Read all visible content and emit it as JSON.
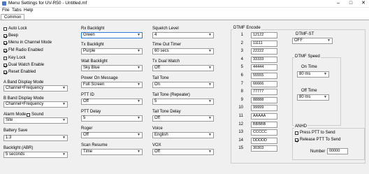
{
  "window": {
    "title": "Menu Settings for UV-R50 - Untitled.mf"
  },
  "menu": [
    "File",
    "Tabs",
    "Help"
  ],
  "tab": "Common",
  "col1": {
    "checks": [
      {
        "label": "Auto Lock",
        "checked": false
      },
      {
        "label": "Beep",
        "checked": true
      },
      {
        "label": "Menu in Channel Mode",
        "checked": true
      },
      {
        "label": "FM Radio Enabled",
        "checked": true
      },
      {
        "label": "Key Lock",
        "checked": false
      },
      {
        "label": "Dual Watch Enable",
        "checked": true
      },
      {
        "label": "Reset Enabled",
        "checked": true
      }
    ],
    "a_band_label": "A Band Display Mode",
    "a_band_value": "Channel+Frequency",
    "b_band_label": "B Band Display Mode",
    "b_band_value": "Channel+Frequency",
    "alarm_label": "Alarm Mode",
    "sound_label": "Sound",
    "alarm_value": "Site",
    "battery_label": "Battery Save",
    "battery_value": "1:3",
    "backlight_label": "Backlight (ABR)",
    "backlight_value": "5 seconds"
  },
  "col2": [
    {
      "label": "Rx Backlight",
      "value": "Green"
    },
    {
      "label": "Tx Backlight",
      "value": "Purple"
    },
    {
      "label": "Wait Backlight",
      "value": "Sky Blue"
    },
    {
      "label": "Power On Message",
      "value": "Full Screen"
    },
    {
      "label": "PTT ID",
      "value": "Off"
    },
    {
      "label": "PTT Delay",
      "value": "5"
    },
    {
      "label": "Roger",
      "value": "Off"
    },
    {
      "label": "Scan Resume",
      "value": "Time"
    }
  ],
  "col3": [
    {
      "label": "Squelch Level",
      "value": "4"
    },
    {
      "label": "Time Out Timer",
      "value": "60 secs"
    },
    {
      "label": "Tx Dual Watch",
      "value": "Off"
    },
    {
      "label": "Tail Tone",
      "value": "On"
    },
    {
      "label": "Tail Tone (Repeater)",
      "value": "5"
    },
    {
      "label": "Tail Tone Delay",
      "value": "Off"
    },
    {
      "label": "Voice",
      "value": "English"
    },
    {
      "label": "VOX",
      "value": "Off"
    }
  ],
  "dtmf": {
    "title": "DTMF Encode",
    "rows": [
      {
        "n": "1",
        "v": "12122"
      },
      {
        "n": "2",
        "v": "11111"
      },
      {
        "n": "3",
        "v": "22222"
      },
      {
        "n": "4",
        "v": "33333"
      },
      {
        "n": "5",
        "v": "44444"
      },
      {
        "n": "6",
        "v": "55555"
      },
      {
        "n": "7",
        "v": "66666"
      },
      {
        "n": "8",
        "v": "77777"
      },
      {
        "n": "9",
        "v": "88888"
      },
      {
        "n": "10",
        "v": "99999"
      },
      {
        "n": "11",
        "v": "AAAAA"
      },
      {
        "n": "12",
        "v": "BBBBB"
      },
      {
        "n": "13",
        "v": "CCCCC"
      },
      {
        "n": "14",
        "v": "DDDDD"
      },
      {
        "n": "15",
        "v": "30303"
      }
    ]
  },
  "dtmf_st": {
    "label": "DTMF-ST",
    "value": "OFF"
  },
  "dtmf_speed": {
    "title": "DTMF Speed",
    "on_label": "On Time",
    "on_value": "80 ms",
    "off_label": "Off Time",
    "off_value": "80 ms"
  },
  "anhd": {
    "title": "ANHD",
    "press_label": "Press PTT to Send",
    "press_checked": false,
    "release_label": "Release PTT To Send",
    "release_checked": true,
    "number_label": "Number",
    "number_value": "00000"
  }
}
